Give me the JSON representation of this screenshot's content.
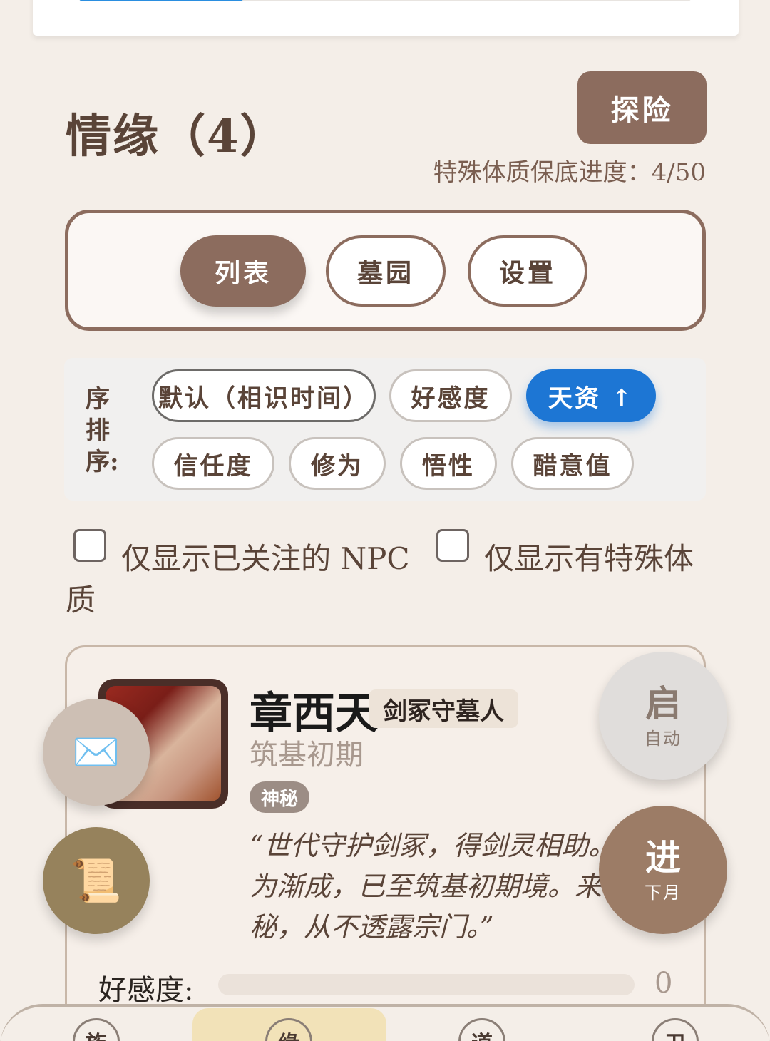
{
  "top_card": {
    "progress": 0.27
  },
  "section": {
    "title": "情缘（4）"
  },
  "explore_button": "探险",
  "special_progress": "特殊体质保底进度：4/50",
  "view_tabs": [
    {
      "label": "列表",
      "active": true
    },
    {
      "label": "墓园",
      "active": false
    },
    {
      "label": "设置",
      "active": false
    }
  ],
  "sort": {
    "label": "序排序:",
    "options": [
      {
        "label": "默认（相识时间）",
        "active": false
      },
      {
        "label": "好感度",
        "active": false
      },
      {
        "label": "天资 ↑",
        "active": true
      },
      {
        "label": "信任度",
        "active": false
      },
      {
        "label": "修为",
        "active": false
      },
      {
        "label": "悟性",
        "active": false
      },
      {
        "label": "醋意值",
        "active": false
      }
    ]
  },
  "filters": {
    "followed_npc": {
      "label": "仅显示已关注的 NPC",
      "checked": false
    },
    "special_physique": {
      "label": "仅显示有特殊体",
      "label_wrap": "质",
      "checked": false
    }
  },
  "npc": {
    "name": "章西天",
    "title": "剑冢守墓人",
    "realm": "筑基初期",
    "tag": "神秘",
    "quote": "“世代守护剑冢，得剑灵相助。\n为渐成，已至筑基初期境。来\n秘，从不透露宗门。”",
    "affection_label": "好感度:",
    "affection_value": "0",
    "affection_fraction": 0
  },
  "fabs": {
    "mail_icon": "✉️",
    "scroll_icon": "📜",
    "auto": {
      "main": "启",
      "sub": "自动"
    },
    "next": {
      "main": "进",
      "sub": "下月"
    }
  },
  "bottom_nav": [
    {
      "label": "族",
      "active": false
    },
    {
      "label": "缘",
      "active": true
    },
    {
      "label": "道",
      "active": false
    },
    {
      "label": "卫",
      "active": false
    }
  ]
}
